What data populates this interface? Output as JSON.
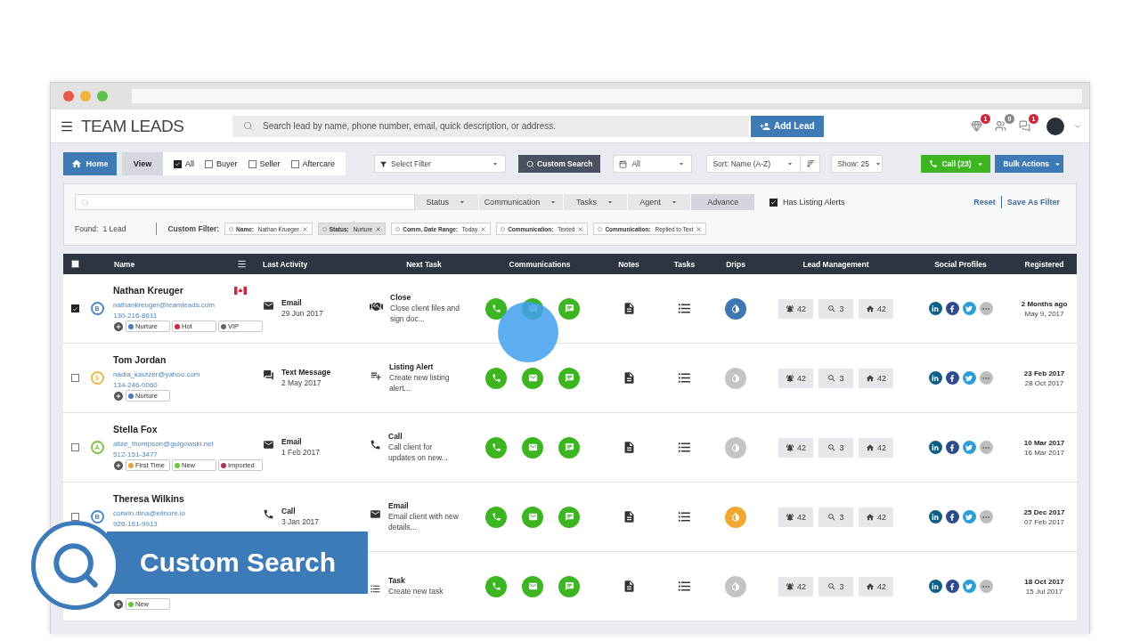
{
  "header": {
    "logo": "TEAM LEADS",
    "search": {
      "placeholder": "Search lead by name, phone number, email, quick description, or address."
    },
    "add_lead": "Add Lead",
    "notifications": [
      {
        "kind": "diamond",
        "count": "1",
        "unread": true
      },
      {
        "kind": "people",
        "count": "0",
        "unread": false
      },
      {
        "kind": "chat",
        "count": "1",
        "unread": true
      }
    ]
  },
  "toolbar": {
    "home": "Home",
    "view": "View",
    "types": [
      {
        "label": "All",
        "checked": true
      },
      {
        "label": "Buyer",
        "checked": false
      },
      {
        "label": "Seller",
        "checked": false
      },
      {
        "label": "Aftercare",
        "checked": false
      }
    ],
    "filter_select": "Select Filter",
    "custom_search": "Custom Search",
    "date": "All",
    "sort": "Sort: Name (A-Z)",
    "show": "Show: 25",
    "call": "Call (23)",
    "bulk": "Bulk Actions"
  },
  "filters": {
    "tabs": [
      {
        "label": "Status",
        "kind": "dropdown",
        "selected": false
      },
      {
        "label": "Communication",
        "kind": "dropdown",
        "selected": false
      },
      {
        "label": "Tasks",
        "kind": "dropdown",
        "selected": false
      },
      {
        "label": "Agent",
        "kind": "dropdown",
        "selected": false
      },
      {
        "label": "Advance",
        "kind": "button",
        "selected": true
      }
    ],
    "listing_alerts": {
      "label": "Has Listing Alerts",
      "checked": true
    },
    "reset": "Reset",
    "save": "Save As Filter",
    "found_label": "Found:",
    "found_value": "1 Lead",
    "custom_filter_label": "Custom Filter:",
    "chips": [
      {
        "key": "Name:",
        "value": "Nathan Krueger",
        "selected": false
      },
      {
        "key": "Status:",
        "value": "Nurture",
        "selected": true
      },
      {
        "key": "Comm. Date Range:",
        "value": "Today",
        "selected": false
      },
      {
        "key": "Communication:",
        "value": "Texted",
        "selected": false
      },
      {
        "key": "Communication:",
        "value": "Replied to Text",
        "selected": false
      }
    ]
  },
  "table": {
    "select_all": {
      "checked": false
    },
    "columns": [
      "Name",
      "Last Activity",
      "Next Task",
      "Communications",
      "Notes",
      "Tasks",
      "Drips",
      "Lead Management",
      "Social Profiles",
      "Registered"
    ],
    "rows": [
      {
        "checked": true,
        "avatar": {
          "letter": "B",
          "color": "#4a86c5"
        },
        "name": "Nathan Kreuger",
        "flag": true,
        "email": "nathankreuger@teamleads.com",
        "phone": "130-216-8611",
        "tags": [
          {
            "label": "Nurture",
            "color": "#4a7fb5"
          },
          {
            "label": "Hot",
            "color": "#d0253f"
          },
          {
            "label": "VIP",
            "color": "#666666"
          }
        ],
        "activity": {
          "kind": "email",
          "label": "Email",
          "date": "29 Jun 2017"
        },
        "task": {
          "kind": "close",
          "title": "Close",
          "text": "Close client files and sign doc..."
        },
        "drip": {
          "color": "#3e78b2"
        },
        "management": [
          "42",
          "3",
          "42"
        ],
        "registered": {
          "primary": "2 Months ago",
          "secondary": "May 9, 2017"
        }
      },
      {
        "checked": false,
        "avatar": {
          "letter": "S",
          "color": "#e8b84a"
        },
        "name": "Tom Jordan",
        "flag": false,
        "email": "nadia_kautzer@yahoo.com",
        "phone": "134-246-0060",
        "tags": [
          {
            "label": "Nurture",
            "color": "#4a7fb5"
          }
        ],
        "activity": {
          "kind": "text",
          "label": "Text Message",
          "date": "2 May 2017"
        },
        "task": {
          "kind": "alert",
          "title": "Listing Alert",
          "text": "Create new listing alert..."
        },
        "drip": {
          "color": "#c4c4c4"
        },
        "management": [
          "42",
          "3",
          "42"
        ],
        "registered": {
          "primary": "23 Feb 2017",
          "secondary": "28 Oct 2017"
        }
      },
      {
        "checked": false,
        "avatar": {
          "letter": "A",
          "color": "#7cc242"
        },
        "name": "Stella Fox",
        "flag": false,
        "email": "alize_thompson@gulgowski.net",
        "phone": "512-151-3477",
        "tags": [
          {
            "label": "First Time",
            "color": "#e8a33a"
          },
          {
            "label": "New",
            "color": "#6cc832"
          },
          {
            "label": "Imported",
            "color": "#b0325a"
          }
        ],
        "activity": {
          "kind": "email",
          "label": "Email",
          "date": "1 Feb 2017"
        },
        "task": {
          "kind": "call",
          "title": "Call",
          "text": "Call client for updates on new..."
        },
        "drip": {
          "color": "#c4c4c4"
        },
        "management": [
          "42",
          "3",
          "42"
        ],
        "registered": {
          "primary": "10 Mar 2017",
          "secondary": "16 Mar 2017"
        }
      },
      {
        "checked": false,
        "avatar": {
          "letter": "B",
          "color": "#4a86c5"
        },
        "name": "Theresa Wilkins",
        "flag": false,
        "email": "corwin.dina@elinore.io",
        "phone": "926-181-9913",
        "activity": {
          "kind": "call",
          "label": "Call",
          "date": "3 Jan 2017"
        },
        "task": {
          "kind": "email",
          "title": "Email",
          "text": "Email client with new details..."
        },
        "drip": {
          "color": "#f0a830"
        },
        "management": [
          "42",
          "3",
          "42"
        ],
        "registered": {
          "primary": "25 Dec 2017",
          "secondary": "07 Feb 2017"
        }
      },
      {
        "tags": [
          {
            "label": "New",
            "color": "#6cc832"
          }
        ],
        "task": {
          "kind": "task",
          "title": "Task",
          "text": "Create new task"
        },
        "drip": {
          "color": "#c4c4c4"
        },
        "management": [
          "42",
          "3",
          "42"
        ],
        "registered": {
          "primary": "18 Oct 2017",
          "secondary": "15 Jul 2017"
        }
      }
    ]
  },
  "overlay": {
    "title": "Custom Search"
  }
}
